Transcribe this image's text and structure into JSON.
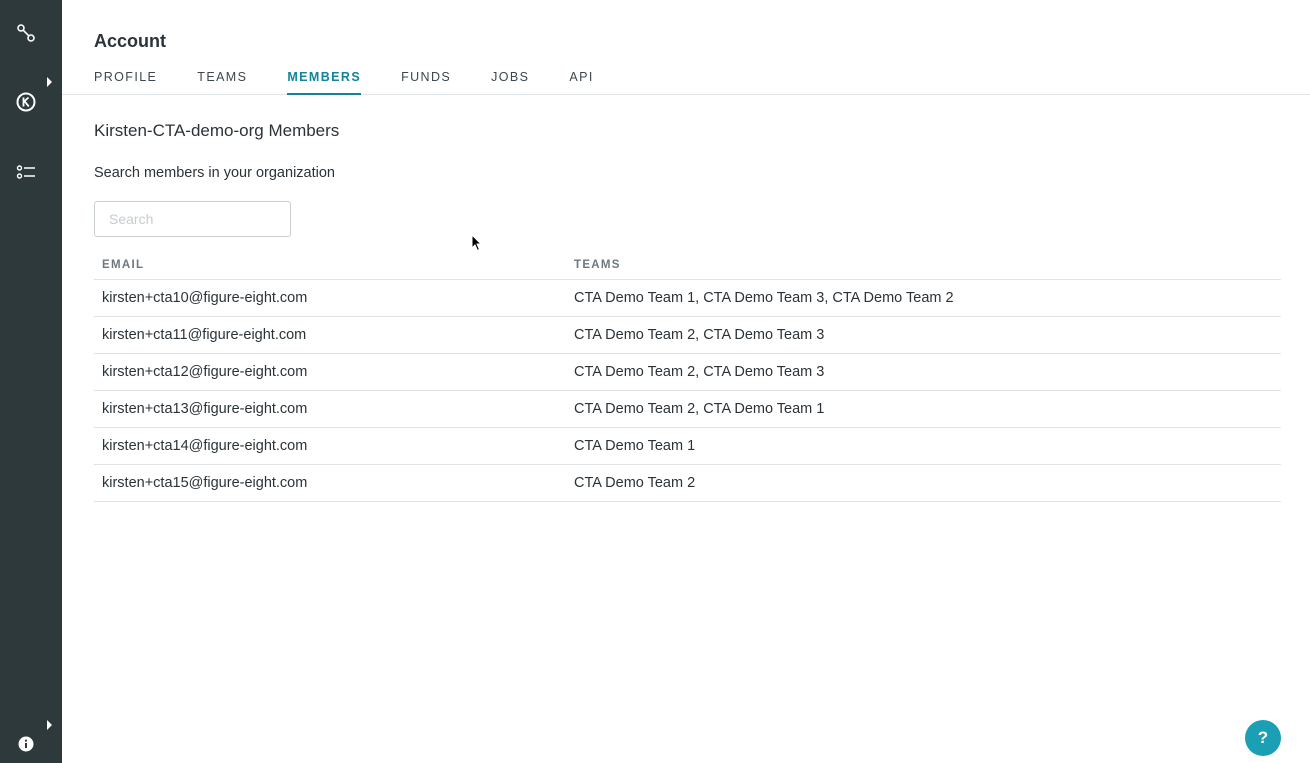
{
  "sidebar": {
    "icons": [
      "workflow-icon",
      "k-logo-icon",
      "list-icon"
    ],
    "bottom_icon": "info-icon"
  },
  "header": {
    "title": "Account",
    "tabs": [
      {
        "label": "PROFILE",
        "active": false
      },
      {
        "label": "TEAMS",
        "active": false
      },
      {
        "label": "MEMBERS",
        "active": true
      },
      {
        "label": "FUNDS",
        "active": false
      },
      {
        "label": "JOBS",
        "active": false
      },
      {
        "label": "API",
        "active": false
      }
    ]
  },
  "main": {
    "org_title": "Kirsten-CTA-demo-org Members",
    "search_label": "Search members in your organization",
    "search": {
      "placeholder": "Search",
      "value": ""
    },
    "table": {
      "columns": [
        "EMAIL",
        "TEAMS"
      ],
      "rows": [
        {
          "email": "kirsten+cta10@figure-eight.com",
          "teams": "CTA Demo Team 1, CTA Demo Team 3, CTA Demo Team 2"
        },
        {
          "email": "kirsten+cta11@figure-eight.com",
          "teams": "CTA Demo Team 2, CTA Demo Team 3"
        },
        {
          "email": "kirsten+cta12@figure-eight.com",
          "teams": "CTA Demo Team 2, CTA Demo Team 3"
        },
        {
          "email": "kirsten+cta13@figure-eight.com",
          "teams": "CTA Demo Team 2, CTA Demo Team 1"
        },
        {
          "email": "kirsten+cta14@figure-eight.com",
          "teams": "CTA Demo Team 1"
        },
        {
          "email": "kirsten+cta15@figure-eight.com",
          "teams": "CTA Demo Team 2"
        }
      ]
    }
  },
  "help_button": {
    "label": "?"
  },
  "colors": {
    "sidebar_bg": "#2d393b",
    "accent": "#13849a",
    "help_button": "#1a9fb4"
  }
}
